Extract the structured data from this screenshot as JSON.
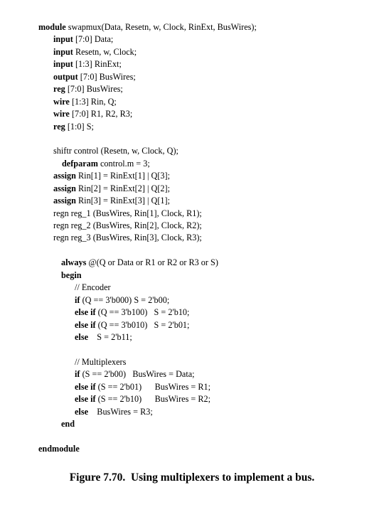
{
  "document": {
    "background_color": "#ffffff",
    "text_color": "#000000",
    "caption": "Figure 7.70.  Using multiplexers to implement a bus."
  },
  "code": {
    "language": "verilog",
    "lines": [
      {
        "indent": 0,
        "keyword": "module",
        "rest": " swapmux(Data, Resetn, w, Clock, RinExt, BusWires);"
      },
      {
        "indent": 1,
        "keyword": "input",
        "rest": " [7:0] Data;"
      },
      {
        "indent": 1,
        "keyword": "input",
        "rest": " Resetn, w, Clock;"
      },
      {
        "indent": 1,
        "keyword": "input",
        "rest": " [1:3] RinExt;"
      },
      {
        "indent": 1,
        "keyword": "output",
        "rest": " [7:0] BusWires;"
      },
      {
        "indent": 1,
        "keyword": "reg",
        "rest": " [7:0] BusWires;"
      },
      {
        "indent": 1,
        "keyword": "wire",
        "rest": " [1:3] Rin, Q;"
      },
      {
        "indent": 1,
        "keyword": "wire",
        "rest": " [7:0] R1, R2, R3;"
      },
      {
        "indent": 1,
        "keyword": "reg",
        "rest": " [1:0] S;"
      },
      {
        "indent": 0,
        "keyword": "",
        "rest": ""
      },
      {
        "indent": 1,
        "keyword": "",
        "rest": "shiftr control (Resetn, w, Clock, Q);"
      },
      {
        "indent": 2,
        "keyword": "defparam",
        "rest": " control.m = 3;"
      },
      {
        "indent": 1,
        "keyword": "assign",
        "rest": " Rin[1] = RinExt[1] | Q[3];"
      },
      {
        "indent": 1,
        "keyword": "assign",
        "rest": " Rin[2] = RinExt[2] | Q[2];"
      },
      {
        "indent": 1,
        "keyword": "assign",
        "rest": " Rin[3] = RinExt[3] | Q[1];"
      },
      {
        "indent": 1,
        "keyword": "",
        "rest": "regn reg_1 (BusWires, Rin[1], Clock, R1);"
      },
      {
        "indent": 1,
        "keyword": "",
        "rest": "regn reg_2 (BusWires, Rin[2], Clock, R2);"
      },
      {
        "indent": 1,
        "keyword": "",
        "rest": "regn reg_3 (BusWires, Rin[3], Clock, R3);"
      },
      {
        "indent": 0,
        "keyword": "",
        "rest": ""
      },
      {
        "indent": 3,
        "keyword": "always",
        "rest": " @(Q or Data or R1 or R2 or R3 or S)"
      },
      {
        "indent": 3,
        "keyword": "begin",
        "rest": ""
      },
      {
        "indent": 4,
        "keyword": "",
        "rest": "// Encoder"
      },
      {
        "indent": 4,
        "keyword": "if",
        "rest": " (Q == 3'b000) S = 2'b00;"
      },
      {
        "indent": 4,
        "keyword": "else if",
        "rest": " (Q == 3'b100)   S = 2'b10;"
      },
      {
        "indent": 4,
        "keyword": "else if",
        "rest": " (Q == 3'b010)   S = 2'b01;"
      },
      {
        "indent": 4,
        "keyword": "else",
        "rest": "    S = 2'b11;"
      },
      {
        "indent": 0,
        "keyword": "",
        "rest": ""
      },
      {
        "indent": 4,
        "keyword": "",
        "rest": "// Multiplexers"
      },
      {
        "indent": 4,
        "keyword": "if",
        "rest": " (S == 2'b00)   BusWires = Data;"
      },
      {
        "indent": 4,
        "keyword": "else if",
        "rest": " (S == 2'b01)      BusWires = R1;"
      },
      {
        "indent": 4,
        "keyword": "else if",
        "rest": " (S == 2'b10)      BusWires = R2;"
      },
      {
        "indent": 4,
        "keyword": "else",
        "rest": "    BusWires = R3;"
      },
      {
        "indent": 3,
        "keyword": "end",
        "rest": ""
      },
      {
        "indent": 0,
        "keyword": "",
        "rest": ""
      },
      {
        "indent": 0,
        "keyword": "endmodule",
        "rest": ""
      }
    ]
  }
}
